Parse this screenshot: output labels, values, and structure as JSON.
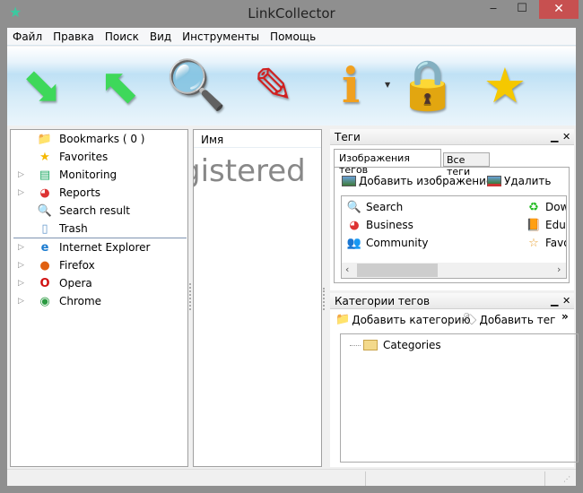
{
  "window": {
    "title": "LinkCollector",
    "minimize": "‒",
    "maximize": "☐",
    "close": "✕"
  },
  "menu": [
    "Файл",
    "Правка",
    "Поиск",
    "Вид",
    "Инструменты",
    "Помощь"
  ],
  "toolbar": [
    {
      "icon": "download-arrow-icon",
      "glyph": "⬊",
      "color": "#3ed85a"
    },
    {
      "icon": "upload-arrow-icon",
      "glyph": "⬉",
      "color": "#3ed85a"
    },
    {
      "icon": "magnifier-icon",
      "glyph": "🔍",
      "color": "#3b9be0"
    },
    {
      "icon": "edit-pencil-icon",
      "glyph": "✎",
      "color": "#d02020"
    },
    {
      "icon": "info-icon",
      "glyph": "ℹ",
      "color": "#f0a020"
    },
    {
      "icon": "padlock-icon",
      "glyph": "🔒",
      "color": "#9a9a9a"
    },
    {
      "icon": "star-icon",
      "glyph": "★",
      "color": "#f5c800"
    }
  ],
  "tree": {
    "items": [
      {
        "label": "Bookmarks ( 0 )",
        "icon": "folder-icon",
        "glyph": "📁",
        "expandable": false
      },
      {
        "label": "Favorites",
        "icon": "star-icon",
        "glyph": "★",
        "expandable": false
      },
      {
        "label": "Monitoring",
        "icon": "monitor-icon",
        "glyph": "▤",
        "expandable": true
      },
      {
        "label": "Reports",
        "icon": "pie-chart-icon",
        "glyph": "◕",
        "expandable": true
      },
      {
        "label": "Search result",
        "icon": "search-icon",
        "glyph": "🔍",
        "expandable": false
      },
      {
        "label": "Trash",
        "icon": "trash-icon",
        "glyph": "▯",
        "expandable": false
      }
    ],
    "browsers": [
      {
        "label": "Internet Explorer",
        "icon": "internet-explorer-icon",
        "glyph": "e"
      },
      {
        "label": "Firefox",
        "icon": "firefox-icon",
        "glyph": "●"
      },
      {
        "label": "Opera",
        "icon": "opera-icon",
        "glyph": "O"
      },
      {
        "label": "Chrome",
        "icon": "chrome-icon",
        "glyph": "◉"
      }
    ]
  },
  "list": {
    "column": "Имя",
    "watermark": "gistered"
  },
  "tags_panel": {
    "title": "Теги",
    "tabs": [
      "Изображения тегов",
      "Все теги"
    ],
    "add_image": "Добавить изображение",
    "delete": "Удалить",
    "items_left": [
      {
        "label": "Search",
        "glyph": "🔍",
        "icon": "search-icon"
      },
      {
        "label": "Business",
        "glyph": "◕",
        "icon": "business-chart-icon"
      },
      {
        "label": "Community",
        "glyph": "👥",
        "icon": "community-icon"
      }
    ],
    "items_right": [
      {
        "label": "Down",
        "glyph": "♻",
        "icon": "download-icon"
      },
      {
        "label": "Educa",
        "glyph": "📙",
        "icon": "education-book-icon"
      },
      {
        "label": "Favor",
        "glyph": "☆",
        "icon": "favorites-star-icon"
      }
    ]
  },
  "categories_panel": {
    "title": "Категории тегов",
    "add_category": "Добавить категорию",
    "add_tag": "Добавить тег",
    "more": "»",
    "root": "Categories"
  }
}
